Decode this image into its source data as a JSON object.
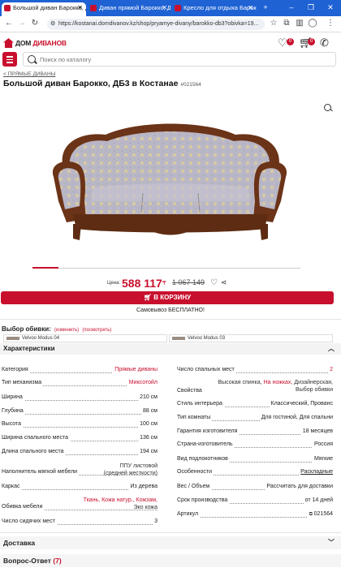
{
  "browser": {
    "tabs": [
      {
        "label": "Большой диван Барокко, Д",
        "active": true
      },
      {
        "label": "Диван прямой Барокко, Д",
        "active": false
      },
      {
        "label": "Кресло для отдыха Бароккс",
        "active": false
      }
    ],
    "url": "https://kostanai.domdivanov.kz/shop/pryamye-divany/barokko-db3?obivka=19...",
    "new_tab": "+",
    "min": "–",
    "max": "❐",
    "close": "✕"
  },
  "header": {
    "logo_prefix": "ДОМ",
    "logo_brand": "ДИВАНОВ",
    "favorites_count": "0",
    "cart_count": "0",
    "search_placeholder": "Поиск по каталогу"
  },
  "breadcrumb": "< ПРЯМЫЕ ДИВАНЫ",
  "product": {
    "title": "Большой диван Барокко, ДБ3 в Костанае",
    "sku": "#021564",
    "price_label": "Цена:",
    "price": "588 117",
    "currency": "₸",
    "old_price": "1 067 149",
    "cart_button": "В КОРЗИНУ",
    "pickup": "Самовывоз БЕСПЛАТНО!"
  },
  "upholstery": {
    "title": "Выбор обивки:",
    "change": "(изменить)",
    "view": "(посмотреть)",
    "fabrics": [
      "Velvoo Modus 04",
      "Velvoo Modus 03"
    ]
  },
  "sections": {
    "characteristics": "Характеристики",
    "delivery": "Доставка",
    "qa": "Вопрос-Ответ",
    "qa_count": "(7)"
  },
  "specs_left": [
    {
      "label": "Категория",
      "value": "Прямые диваны",
      "red": true
    },
    {
      "label": "Тип механизма",
      "value": "Миксотойл",
      "red": true
    },
    {
      "label": "Ширина",
      "value": "210 см"
    },
    {
      "label": "Глубина",
      "value": "88 см"
    },
    {
      "label": "Высота",
      "value": "100 см"
    },
    {
      "label": "Ширина спального места",
      "value": "136 см"
    },
    {
      "label": "Длина спального места",
      "value": "194 см"
    },
    {
      "label": "Наполнитель мягкой мебели",
      "value1": "ППУ листовой",
      "value2": "(средней жесткости)",
      "red": true
    },
    {
      "label": "Каркас",
      "value": "Из дерева"
    },
    {
      "label": "Обивка мебели",
      "value_red": "Ткань, Кожа натур., Кожзам,",
      "value2": "Эко кожа"
    },
    {
      "label": "Число сидячих мест",
      "value": "3"
    }
  ],
  "specs_right": [
    {
      "label": "Число спальных мест",
      "value": "2",
      "red": true
    },
    {
      "label": "Свойства",
      "line1": "Высокая спинка,",
      "line1_red": "На ножках,",
      "line1_end": "Дизайнерская,",
      "line2": "Выбор обивки"
    },
    {
      "label": "Стиль интерьера",
      "value": "Классический, Прованс"
    },
    {
      "label": "Тип комнаты",
      "value": "Для гостиной, Для спальни"
    },
    {
      "label": "Гарантия изготовителя",
      "value": "18 месяцев"
    },
    {
      "label": "Страна-изготовитель",
      "value": "Россия"
    },
    {
      "label": "Вид подлокотников",
      "value": "Мягкие"
    },
    {
      "label": "Особенности",
      "value": "Раскладные"
    },
    {
      "label": "Вес / Объем",
      "value": "Рассчитать для доставки"
    },
    {
      "label": "Срок производства",
      "value": "от 14 дней"
    },
    {
      "label": "Артикул",
      "value": "021564"
    }
  ],
  "colors": {
    "brand": "#c8102e",
    "browser": "#1f62d4"
  }
}
